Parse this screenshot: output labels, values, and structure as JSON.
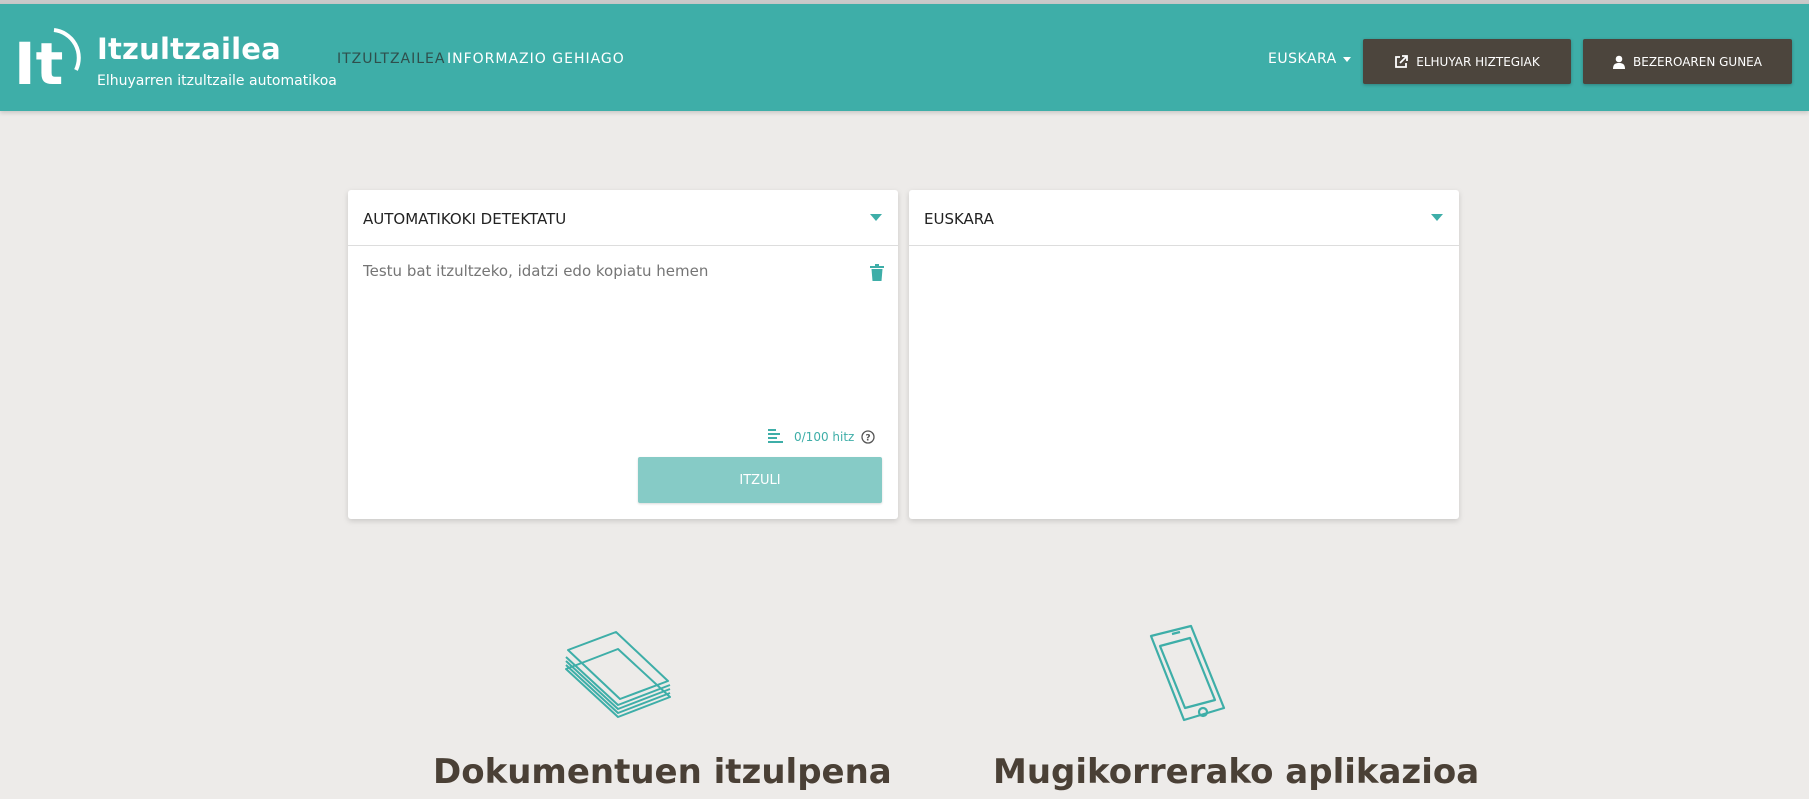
{
  "brand": {
    "logo_text": "It",
    "title": "Itzultzailea",
    "subtitle": "Elhuyarren itzultzaile automatikoa"
  },
  "nav": {
    "items": [
      {
        "label": "ITZULTZAILEA",
        "active": true
      },
      {
        "label": "INFORMAZIO GEHIAGO",
        "active": false
      }
    ]
  },
  "header_right": {
    "language": "EUSKARA",
    "dictionaries_button": "ELHUYAR HIZTEGIAK",
    "user_button": "BEZEROAREN GUNEA"
  },
  "translator": {
    "source_language": "AUTOMATIKOKI DETEKTATU",
    "target_language": "EUSKARA",
    "source_placeholder": "Testu bat itzultzeko, idatzi edo kopiatu hemen",
    "source_value": "",
    "word_count": "0/100 hitz",
    "translate_button": "ITZULI"
  },
  "features": [
    {
      "title": "Dokumentuen itzulpena",
      "icon": "documents-icon"
    },
    {
      "title": "Mugikorrerako aplikazioa",
      "icon": "smartphone-icon"
    }
  ],
  "colors": {
    "accent": "#3eaea8",
    "dark_button": "#4c453d",
    "background": "#edebe9",
    "translate_button": "#86cbc6"
  }
}
